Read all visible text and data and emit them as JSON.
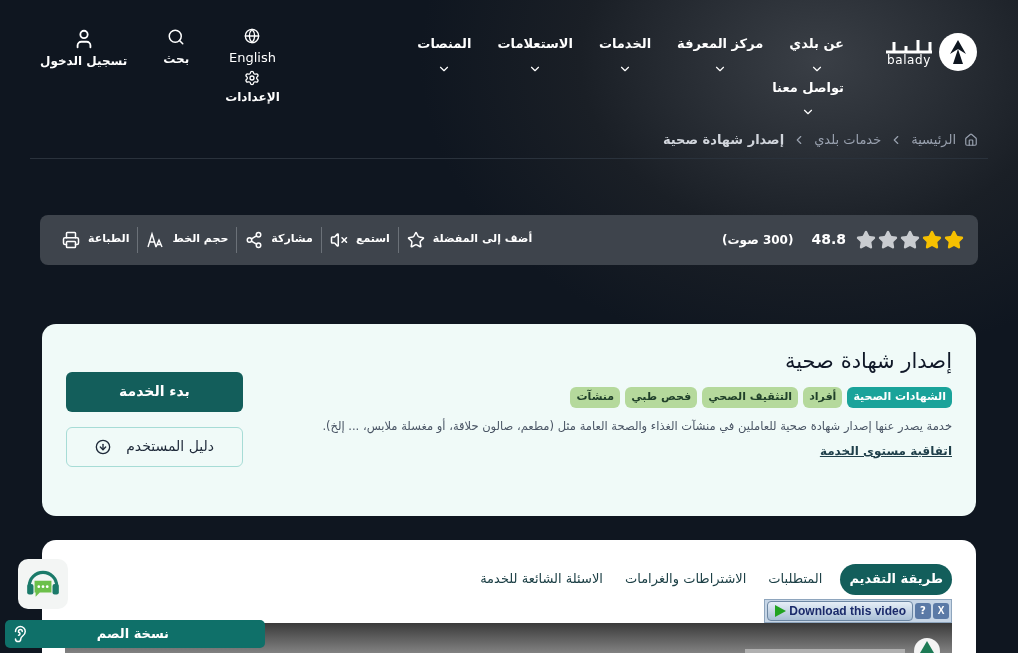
{
  "header": {
    "logo": {
      "wordmark": "balady"
    },
    "nav": [
      {
        "label": "عن بلدي"
      },
      {
        "label": "مركز المعرفة"
      },
      {
        "label": "الخدمات"
      },
      {
        "label": "الاستعلامات"
      },
      {
        "label": "المنصات"
      },
      {
        "label": "تواصل معنا"
      }
    ],
    "language": "English",
    "settings": "الإعدادات",
    "search": "بحث",
    "login": "تسجيل الدخول"
  },
  "breadcrumb": [
    {
      "label": "الرئيسية",
      "current": false
    },
    {
      "label": "خدمات بلدي",
      "current": false
    },
    {
      "label": "إصدار شهادة صحية",
      "current": true
    }
  ],
  "toolbar": {
    "stars": 2,
    "rating": "48.8",
    "votes": "(300 صوت)",
    "actions": [
      {
        "kind": "favorite",
        "label": "أضف إلى المفضلة"
      },
      {
        "kind": "listen",
        "label": "استمع"
      },
      {
        "kind": "share",
        "label": "مشاركة"
      },
      {
        "kind": "font",
        "label": "حجم الخط"
      },
      {
        "kind": "print",
        "label": "الطباعة"
      }
    ]
  },
  "service": {
    "title": "إصدار شهادة صحية",
    "tags": [
      {
        "label": "الشهادات الصحية",
        "kind": "primary"
      },
      {
        "label": "أفراد",
        "kind": "secondary"
      },
      {
        "label": "التثقيف الصحي",
        "kind": "secondary"
      },
      {
        "label": "فحص طبي",
        "kind": "secondary"
      },
      {
        "label": "منشآت",
        "kind": "secondary"
      }
    ],
    "description": "خدمة يصدر عنها إصدار شهادة صحية للعاملين في منشآت الغذاء والصحة العامة مثل (مطعم، صالون حلاقة، أو مغسلة ملابس، ... إلخ).",
    "sla_link": "اتفاقية مستوى الخدمة",
    "start_button": "بدء الخدمة",
    "guide_button": "دليل المستخدم"
  },
  "tabs": [
    {
      "label": "طريقة التقديم",
      "selected": true
    },
    {
      "label": "المتطلبات",
      "selected": false
    },
    {
      "label": "الاشتراطات والغرامات",
      "selected": false
    },
    {
      "label": "الاسئلة الشائعة للخدمة",
      "selected": false
    }
  ],
  "video_widget": {
    "download": "Download this video",
    "help": "?",
    "close": "X"
  },
  "deaf_bar": {
    "label": "نسخة الصم"
  }
}
